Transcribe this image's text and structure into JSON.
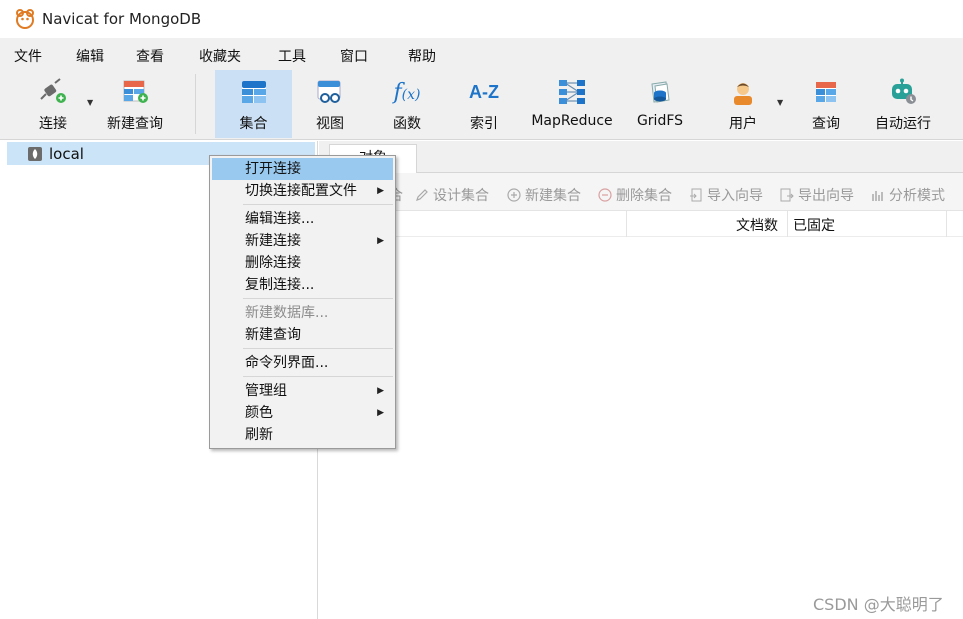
{
  "window": {
    "title": "Navicat for MongoDB"
  },
  "menu": [
    "文件",
    "编辑",
    "查看",
    "收藏夹",
    "工具",
    "窗口",
    "帮助"
  ],
  "toolbar": {
    "items": [
      {
        "label": "连接",
        "icon": "plug-connect-icon"
      },
      {
        "label": "新建查询",
        "icon": "new-query-icon"
      },
      {
        "label": "集合",
        "icon": "collection-icon",
        "active": true
      },
      {
        "label": "视图",
        "icon": "view-icon"
      },
      {
        "label": "函数",
        "icon": "function-icon"
      },
      {
        "label": "索引",
        "icon": "index-icon"
      },
      {
        "label": "MapReduce",
        "icon": "mapreduce-icon"
      },
      {
        "label": "GridFS",
        "icon": "gridfs-icon"
      },
      {
        "label": "用户",
        "icon": "user-icon"
      },
      {
        "label": "查询",
        "icon": "query-icon"
      },
      {
        "label": "自动运行",
        "icon": "robot-icon"
      }
    ]
  },
  "tree": {
    "connection": "local"
  },
  "tabs": {
    "objects": "对象"
  },
  "object_actions": [
    "合",
    "设计集合",
    "新建集合",
    "删除集合",
    "导入向导",
    "导出向导",
    "分析模式"
  ],
  "columns": [
    "文档数",
    "已固定"
  ],
  "context_menu": {
    "items": [
      {
        "label": "打开连接",
        "highlight": true
      },
      {
        "label": "切换连接配置文件",
        "submenu": true
      },
      {
        "label": "编辑连接..."
      },
      {
        "label": "新建连接",
        "submenu": true
      },
      {
        "label": "删除连接"
      },
      {
        "label": "复制连接..."
      },
      {
        "label": "新建数据库...",
        "disabled": true
      },
      {
        "label": "新建查询"
      },
      {
        "label": "命令列界面..."
      },
      {
        "label": "管理组",
        "submenu": true
      },
      {
        "label": "颜色",
        "submenu": true
      },
      {
        "label": "刷新"
      }
    ]
  },
  "watermark": "CSDN @大聪明了",
  "colors": {
    "accent_selected": "#cce0f5",
    "menu_highlight": "#99c9ef",
    "disabled_text": "#9a9a9a"
  }
}
